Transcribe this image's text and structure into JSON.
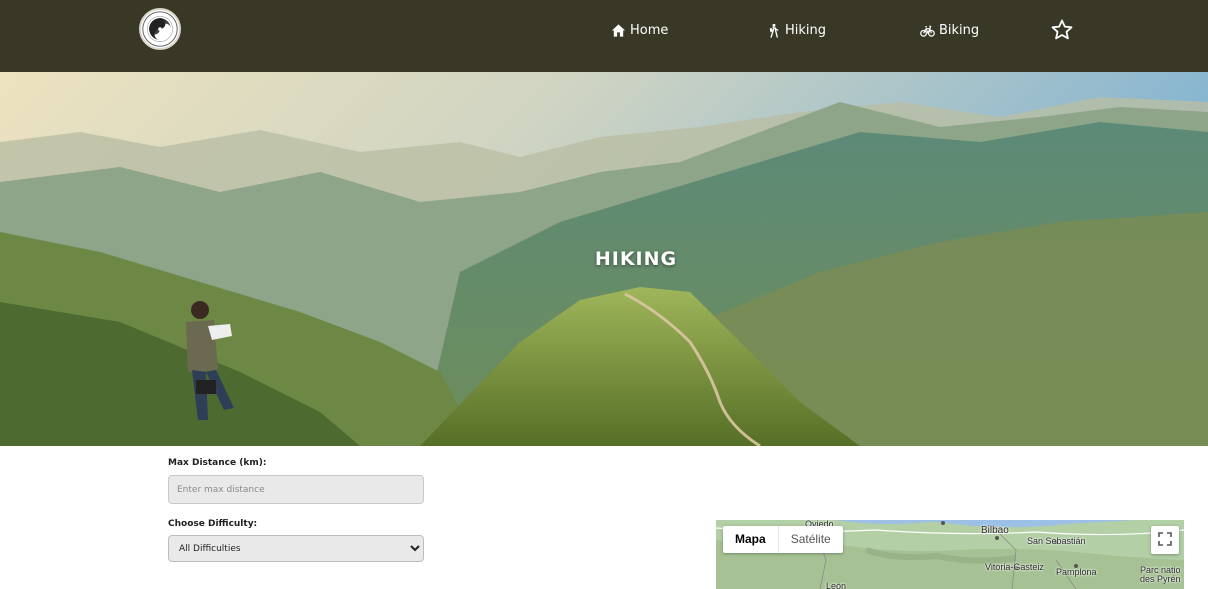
{
  "nav": {
    "logo": "logo-emblem",
    "items": [
      {
        "label": "Home",
        "icon": "home-icon"
      },
      {
        "label": "Hiking",
        "icon": "hiker-icon"
      },
      {
        "label": "Biking",
        "icon": "bicycle-icon"
      }
    ],
    "favorites_icon": "star-icon"
  },
  "hero": {
    "title": "HIKING"
  },
  "filters": {
    "distance": {
      "label": "Max Distance (km):",
      "placeholder": "Enter max distance",
      "value": ""
    },
    "difficulty": {
      "label": "Choose Difficulty:",
      "selected": "All Difficulties"
    }
  },
  "map": {
    "type_buttons": [
      "Mapa",
      "Satélite"
    ],
    "active_type": "Mapa",
    "fullscreen_icon": "fullscreen-icon",
    "places": [
      "Oviedo",
      "Bilbao",
      "San Sebastián",
      "Vitoria-Gasteiz",
      "Pamplona",
      "León",
      "Parc natio des Pyrén"
    ]
  },
  "colors": {
    "nav_background": "#393827",
    "nav_text": "#ffffff",
    "input_background": "#e9e9e9"
  }
}
